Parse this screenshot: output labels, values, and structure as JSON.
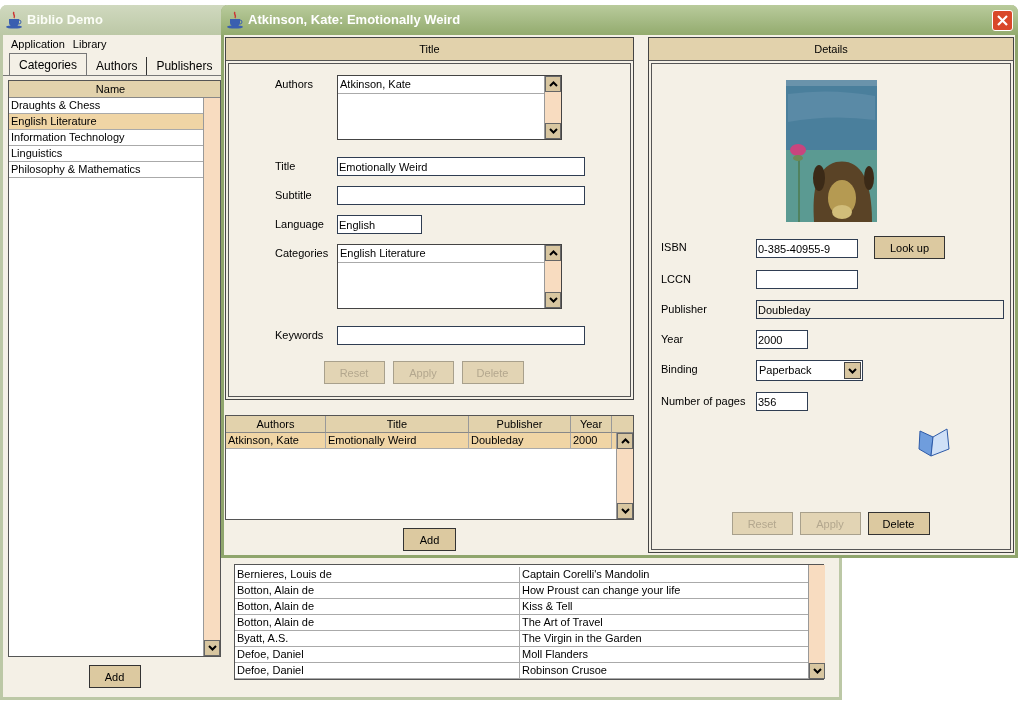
{
  "main_window": {
    "title": "Biblio Demo",
    "menu": [
      "Application",
      "Library"
    ],
    "tabs": [
      {
        "label": "Categories",
        "selected": true
      },
      {
        "label": "Authors",
        "selected": false
      },
      {
        "label": "Publishers",
        "selected": false
      }
    ],
    "categories_table": {
      "columns": [
        "Name"
      ],
      "rows": [
        {
          "name": "Draughts & Chess",
          "selected": false
        },
        {
          "name": "English Literature",
          "selected": true
        },
        {
          "name": "Information Technology",
          "selected": false
        },
        {
          "name": "Linguistics",
          "selected": false
        },
        {
          "name": "Philosophy & Mathematics",
          "selected": false
        }
      ]
    },
    "add_button": "Add",
    "books_table": {
      "rows": [
        [
          "Bernieres, Louis de",
          "Captain Corelli's Mandolin"
        ],
        [
          "Botton, Alain de",
          "How Proust can change your life"
        ],
        [
          "Botton, Alain de",
          "Kiss & Tell"
        ],
        [
          "Botton, Alain de",
          "The Art of Travel"
        ],
        [
          "Byatt, A.S.",
          "The Virgin in the Garden"
        ],
        [
          "Defoe, Daniel",
          "Moll Flanders"
        ],
        [
          "Defoe, Daniel",
          "Robinson Crusoe"
        ]
      ]
    }
  },
  "book_window": {
    "title": "Atkinson, Kate: Emotionally Weird",
    "title_panel": {
      "heading": "Title",
      "fields": [
        {
          "kind": "list",
          "label": "Authors",
          "items": [
            "Atkinson, Kate"
          ]
        },
        {
          "kind": "text",
          "label": "Title",
          "value": "Emotionally Weird"
        },
        {
          "kind": "text",
          "label": "Subtitle"
        },
        {
          "kind": "text",
          "label": "Language",
          "value": "English"
        },
        {
          "kind": "list",
          "label": "Categories",
          "items": [
            "English Literature"
          ]
        },
        {
          "kind": "text",
          "label": "Keywords"
        }
      ],
      "buttons": [
        {
          "label": "Reset",
          "disabled": true
        },
        {
          "label": "Apply",
          "disabled": true
        },
        {
          "label": "Delete",
          "disabled": true
        }
      ]
    },
    "editions_table": {
      "columns": [
        "Authors",
        "Title",
        "Publisher",
        "Year"
      ],
      "rows": [
        {
          "cells": [
            "Atkinson, Kate",
            "Emotionally Weird",
            "Doubleday",
            "2000"
          ],
          "selected": true
        }
      ]
    },
    "add_button": "Add",
    "details_panel": {
      "heading": "Details",
      "fields": [
        {
          "kind": "text",
          "label": "ISBN",
          "value": "0-385-40955-9",
          "button": "Look up"
        },
        {
          "kind": "text",
          "label": "LCCN"
        },
        {
          "kind": "readonly",
          "label": "Publisher",
          "value": "Doubleday"
        },
        {
          "kind": "text",
          "label": "Year",
          "value": "2000"
        },
        {
          "kind": "select",
          "label": "Binding",
          "value": "Paperback"
        },
        {
          "kind": "text",
          "label": "Number of pages",
          "value": "356"
        }
      ],
      "buttons": [
        {
          "label": "Reset",
          "disabled": true
        },
        {
          "label": "Apply",
          "disabled": true
        },
        {
          "label": "Delete",
          "disabled": false
        }
      ]
    }
  }
}
